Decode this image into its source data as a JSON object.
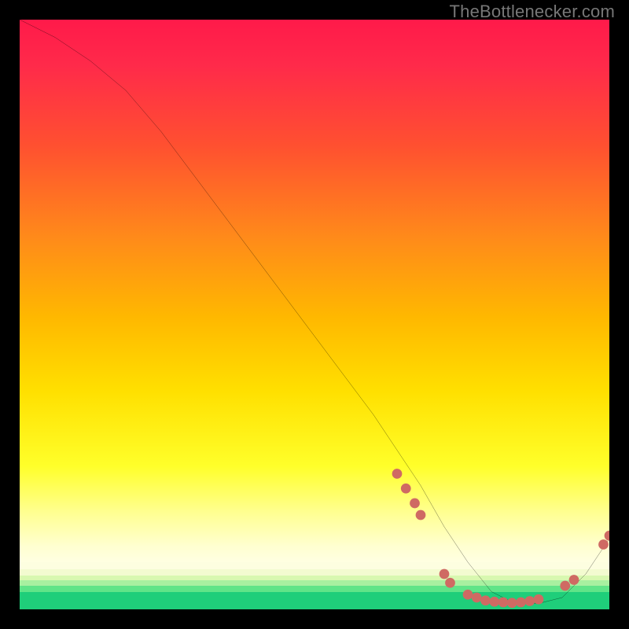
{
  "watermark": "TheBottlenecker.com",
  "colors": {
    "curve": "#000000",
    "marker": "#cf6a63",
    "bg_black": "#000000"
  },
  "chart_data": {
    "type": "line",
    "title": "",
    "xlabel": "",
    "ylabel": "",
    "xlim": [
      0,
      100
    ],
    "ylim": [
      0,
      100
    ],
    "grid": false,
    "legend": false,
    "series": [
      {
        "name": "bottleneck-curve",
        "x": [
          0,
          6,
          12,
          18,
          24,
          30,
          36,
          42,
          48,
          54,
          60,
          64,
          68,
          72,
          76,
          80,
          84,
          88,
          92,
          96,
          100
        ],
        "y": [
          100,
          97,
          93,
          88,
          81,
          73,
          65,
          57,
          49,
          41,
          33,
          27,
          21,
          14,
          8,
          3,
          1,
          1,
          2,
          6,
          12
        ]
      }
    ],
    "markers": [
      {
        "x": 64.0,
        "y": 23.0
      },
      {
        "x": 65.5,
        "y": 20.5
      },
      {
        "x": 67.0,
        "y": 18.0
      },
      {
        "x": 68.0,
        "y": 16.0
      },
      {
        "x": 72.0,
        "y": 6.0
      },
      {
        "x": 73.0,
        "y": 4.5
      },
      {
        "x": 76.0,
        "y": 2.5
      },
      {
        "x": 77.5,
        "y": 2.0
      },
      {
        "x": 79.0,
        "y": 1.5
      },
      {
        "x": 80.5,
        "y": 1.3
      },
      {
        "x": 82.0,
        "y": 1.2
      },
      {
        "x": 83.5,
        "y": 1.1
      },
      {
        "x": 85.0,
        "y": 1.2
      },
      {
        "x": 86.5,
        "y": 1.4
      },
      {
        "x": 88.0,
        "y": 1.7
      },
      {
        "x": 92.5,
        "y": 4.0
      },
      {
        "x": 94.0,
        "y": 5.0
      },
      {
        "x": 99.0,
        "y": 11.0
      },
      {
        "x": 100.0,
        "y": 12.5
      }
    ],
    "gradient_stops": [
      {
        "pos": 0.0,
        "color": "#ff1a4a"
      },
      {
        "pos": 0.5,
        "color": "#ffb800"
      },
      {
        "pos": 0.8,
        "color": "#ffff2a"
      },
      {
        "pos": 0.95,
        "color": "#a8f0a0"
      },
      {
        "pos": 1.0,
        "color": "#1fce7a"
      }
    ]
  }
}
